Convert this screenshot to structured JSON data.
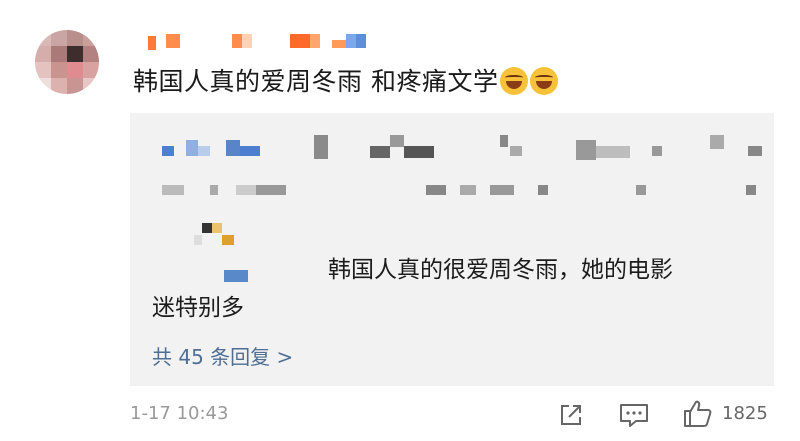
{
  "post": {
    "text": "韩国人真的爱周冬雨 和疼痛文学",
    "emoji": "cry-laugh"
  },
  "quoted_reply": {
    "line1": "韩国人真的很爱周冬雨，她的电影",
    "line2": "迷特别多",
    "more_replies": "共 45 条回复 >"
  },
  "footer": {
    "time": "1-17 10:43",
    "likes": "1825"
  },
  "icons": {
    "share": "share-icon",
    "comment": "comment-icon",
    "like": "thumbs-up-icon"
  },
  "colors": {
    "link": "#4e6e94",
    "quote_bg": "#f2f2f2",
    "meta": "#999999"
  }
}
